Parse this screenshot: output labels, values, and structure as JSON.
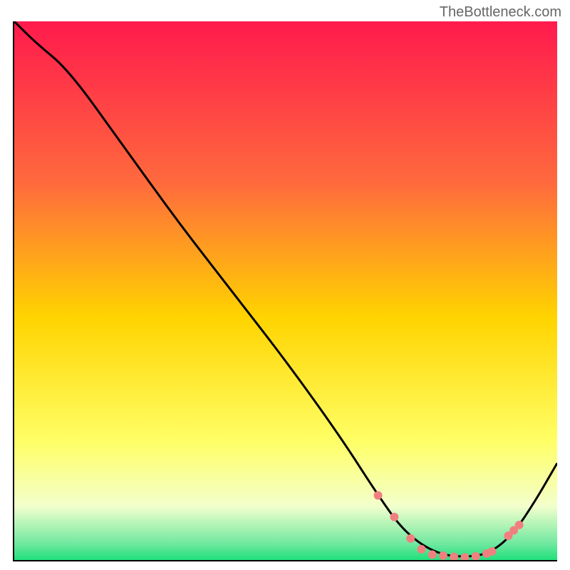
{
  "watermark": "TheBottleneck.com",
  "chart_data": {
    "type": "line",
    "title": "",
    "xlabel": "",
    "ylabel": "",
    "xlim": [
      0,
      100
    ],
    "ylim": [
      0,
      100
    ],
    "background_gradient": {
      "top_color": "#ff1a4d",
      "mid_color": "#ffd400",
      "low_color": "#ffff66",
      "bottom_color": "#1fe07a"
    },
    "series": [
      {
        "name": "bottleneck-curve",
        "color": "#000000",
        "x": [
          0,
          4,
          10,
          20,
          30,
          40,
          50,
          60,
          67,
          72,
          78,
          84,
          88,
          92,
          96,
          100
        ],
        "y": [
          100,
          96,
          91,
          77,
          63,
          50,
          37,
          23,
          12,
          5,
          1,
          0.5,
          1.5,
          5,
          11,
          18
        ]
      }
    ],
    "markers": {
      "name": "highlight-points",
      "color": "#f08080",
      "radius": 6,
      "x": [
        67,
        70,
        73,
        75,
        77,
        79,
        81,
        83,
        85,
        87,
        88,
        91,
        92,
        93
      ],
      "y": [
        12,
        8,
        4,
        2,
        1,
        0.8,
        0.6,
        0.5,
        0.7,
        1.2,
        1.6,
        4.5,
        5.5,
        6.5
      ]
    }
  }
}
